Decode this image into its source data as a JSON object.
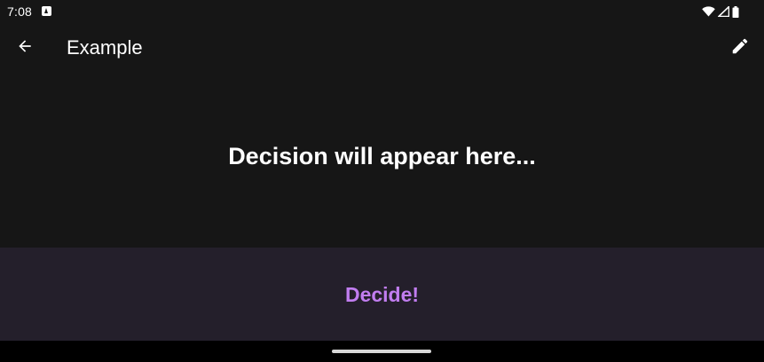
{
  "status_bar": {
    "time": "7:08",
    "icons": [
      "notification-a-icon",
      "wifi-icon",
      "signal-icon",
      "battery-icon"
    ]
  },
  "app_bar": {
    "title": "Example",
    "back_icon": "arrow-back-icon",
    "edit_icon": "pencil-edit-icon"
  },
  "main": {
    "decision_placeholder": "Decision will appear here..."
  },
  "decide_button": {
    "label": "Decide!"
  },
  "colors": {
    "background": "#161616",
    "button_background": "#241f2b",
    "accent": "#c17df0",
    "text": "#ffffff"
  }
}
